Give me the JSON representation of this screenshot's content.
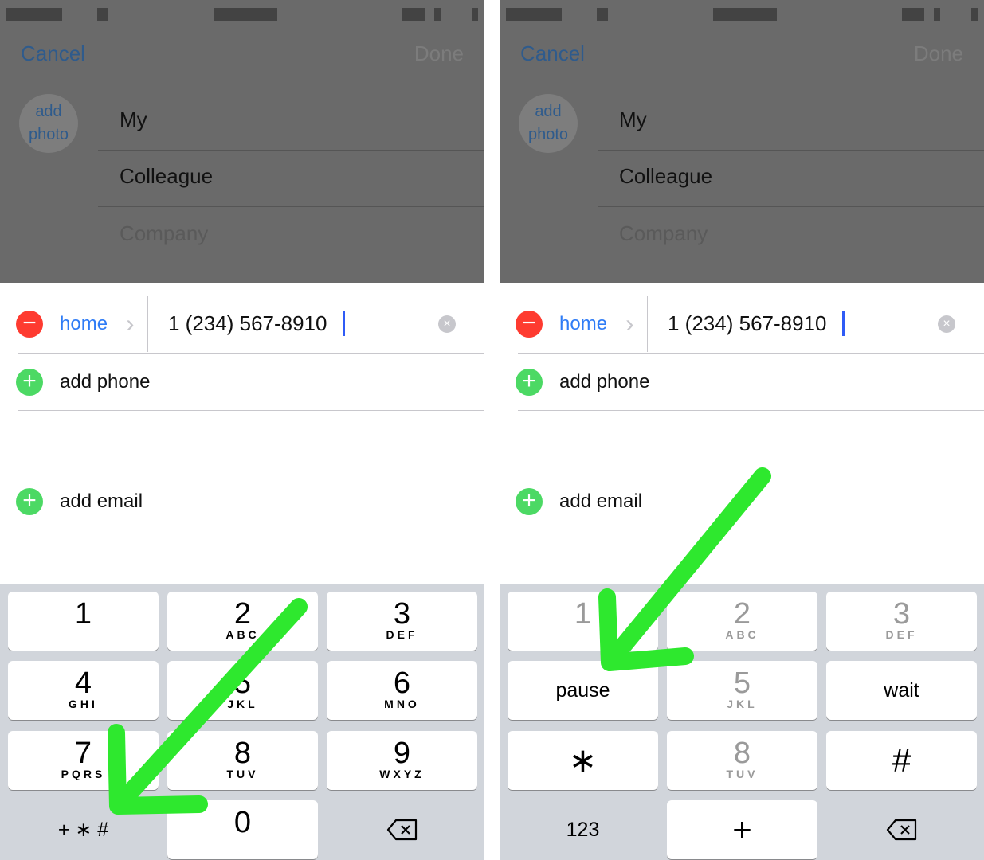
{
  "panels": [
    {
      "nav": {
        "cancel": "Cancel",
        "done": "Done"
      },
      "avatar": "add photo",
      "fields": [
        {
          "value": "My"
        },
        {
          "value": "Colleague"
        },
        {
          "placeholder": "Company"
        }
      ],
      "phone": {
        "label": "home",
        "number": "1 (234) 567-8910"
      },
      "add_phone": "add phone",
      "add_email": "add email",
      "keypad": [
        {
          "digit": "1",
          "letters": ""
        },
        {
          "digit": "2",
          "letters": "ABC"
        },
        {
          "digit": "3",
          "letters": "DEF"
        },
        {
          "digit": "4",
          "letters": "GHI"
        },
        {
          "digit": "5",
          "letters": "JKL"
        },
        {
          "digit": "6",
          "letters": "MNO"
        },
        {
          "digit": "7",
          "letters": "PQRS"
        },
        {
          "digit": "8",
          "letters": "TUV"
        },
        {
          "digit": "9",
          "letters": "WXYZ"
        },
        {
          "word": "+ ∗ #",
          "plain": true
        },
        {
          "digit": "0",
          "letters": ""
        },
        {
          "icon": "backspace-icon",
          "plain": true
        }
      ]
    },
    {
      "nav": {
        "cancel": "Cancel",
        "done": "Done"
      },
      "avatar": "add photo",
      "fields": [
        {
          "value": "My"
        },
        {
          "value": "Colleague"
        },
        {
          "placeholder": "Company"
        }
      ],
      "phone": {
        "label": "home",
        "number": "1 (234) 567-8910"
      },
      "add_phone": "add phone",
      "add_email": "add email",
      "keypad": [
        {
          "digit": "1",
          "letters": "",
          "disabled": true
        },
        {
          "digit": "2",
          "letters": "ABC",
          "disabled": true
        },
        {
          "digit": "3",
          "letters": "DEF",
          "disabled": true
        },
        {
          "word": "pause"
        },
        {
          "digit": "5",
          "letters": "JKL",
          "disabled": true
        },
        {
          "word": "wait"
        },
        {
          "word": "∗",
          "big": true
        },
        {
          "digit": "8",
          "letters": "TUV",
          "disabled": true
        },
        {
          "word": "#",
          "big": true
        },
        {
          "word": "123",
          "plain": true
        },
        {
          "word": "+",
          "big": true
        },
        {
          "icon": "backspace-icon",
          "plain": true
        }
      ]
    }
  ],
  "colors": {
    "annotation_arrow": "#2ee82e",
    "ios_blue": "#2f7cf6",
    "delete_red": "#fe3b30",
    "add_green": "#4cd964"
  }
}
